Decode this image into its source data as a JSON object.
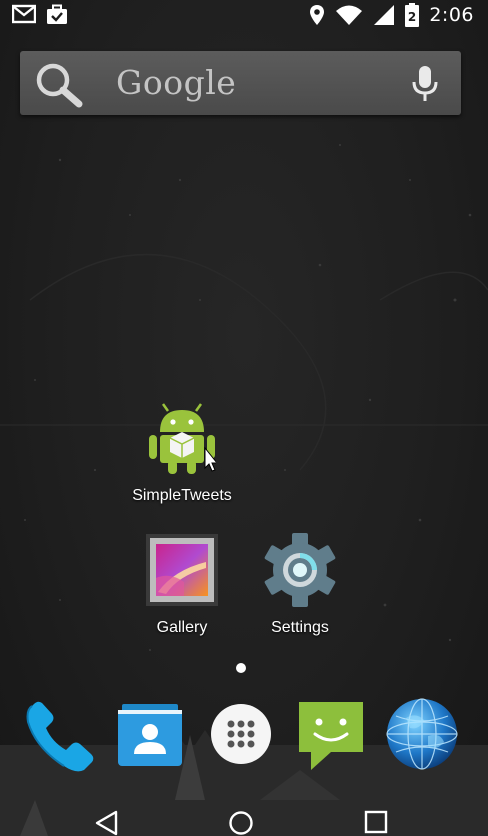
{
  "status_bar": {
    "time": "2:06",
    "left_icons": [
      "gmail-icon",
      "briefcase-check-icon"
    ],
    "right_icons": [
      "location-pin-icon",
      "wifi-icon",
      "signal-icon",
      "battery-icon"
    ]
  },
  "search": {
    "label": "Google",
    "search_icon": "search-icon",
    "voice_icon": "mic-icon"
  },
  "home_apps": [
    {
      "label": "SimpleTweets",
      "icon": "android-robot-icon"
    },
    {
      "label": "Gallery",
      "icon": "gallery-icon"
    },
    {
      "label": "Settings",
      "icon": "gear-icon"
    }
  ],
  "dock": [
    {
      "name": "Phone",
      "icon": "phone-icon"
    },
    {
      "name": "Contacts",
      "icon": "contacts-icon"
    },
    {
      "name": "All apps",
      "icon": "app-drawer-icon"
    },
    {
      "name": "Messaging",
      "icon": "messaging-icon"
    },
    {
      "name": "Browser",
      "icon": "globe-icon"
    }
  ],
  "nav_bar": [
    "back-icon",
    "home-icon",
    "recents-icon"
  ],
  "colors": {
    "android_green": "#9ac33c",
    "phone_blue": "#1aa6e5",
    "contacts_blue": "#2d9be0",
    "messaging_green": "#8dbf3c",
    "settings_gray": "#607d8b",
    "settings_accent": "#80deea"
  }
}
